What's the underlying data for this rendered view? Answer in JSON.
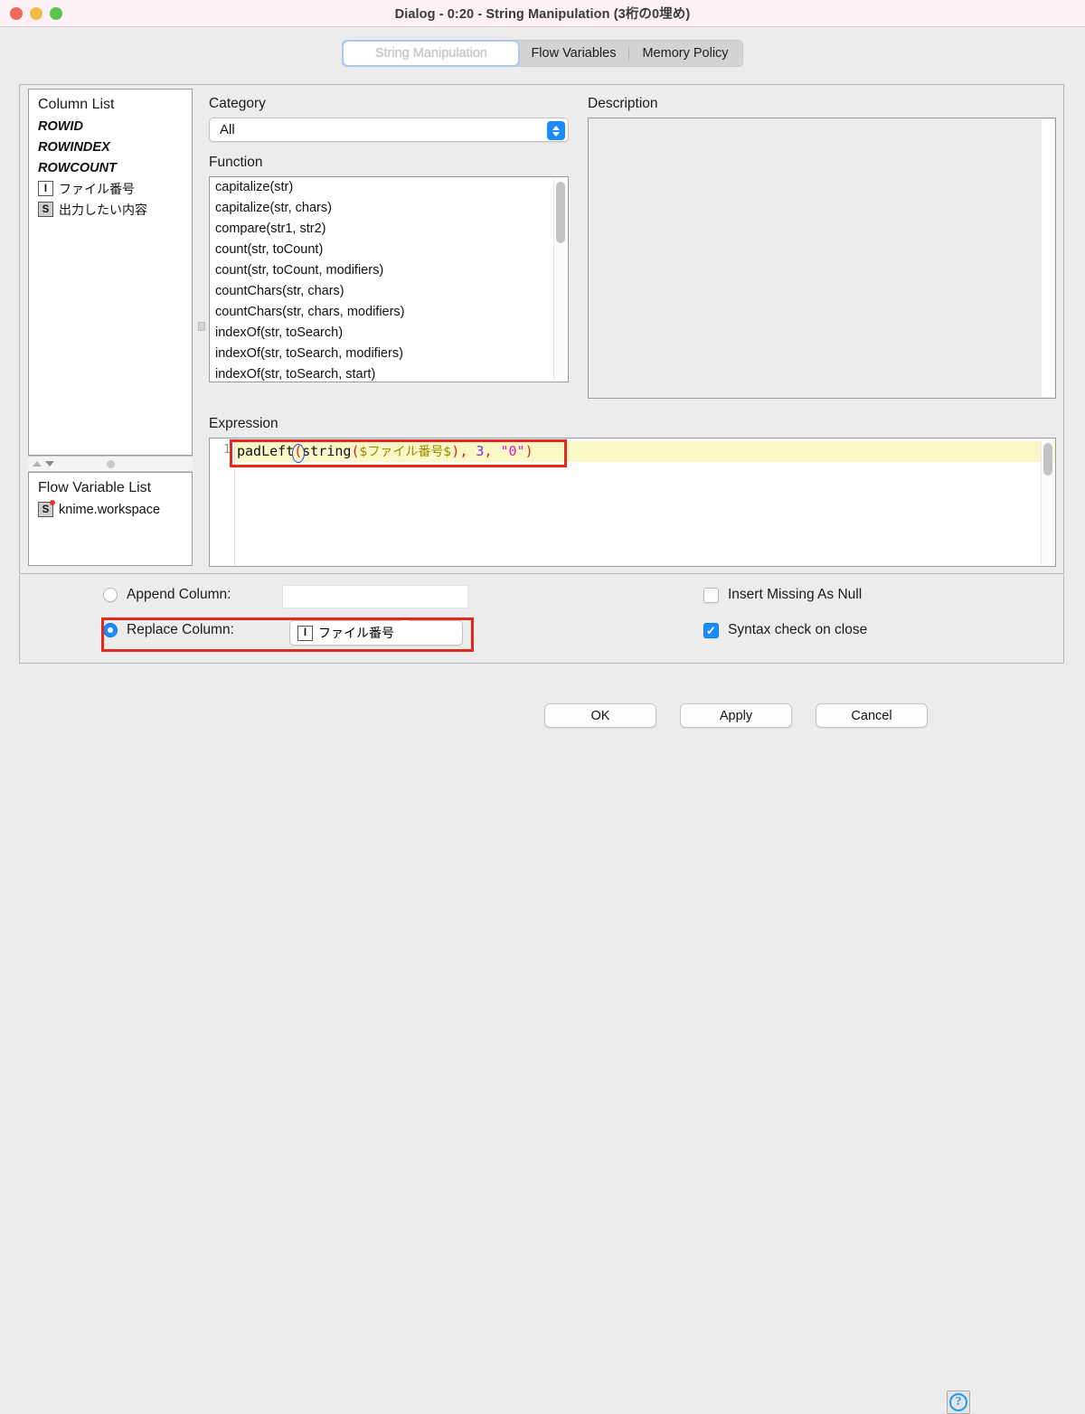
{
  "window": {
    "title": "Dialog - 0:20 - String Manipulation (3桁の0埋め)",
    "traffic_lights": [
      "close-red",
      "minimize-yellow",
      "zoom-green"
    ]
  },
  "tabs": [
    {
      "label": "String Manipulation",
      "active": true
    },
    {
      "label": "Flow Variables",
      "active": false
    },
    {
      "label": "Memory Policy",
      "active": false
    }
  ],
  "column_list": {
    "title": "Column List",
    "items": [
      {
        "label": "ROWID",
        "icon": "",
        "style": "italic"
      },
      {
        "label": "ROWINDEX",
        "icon": "",
        "style": "italic"
      },
      {
        "label": "ROWCOUNT",
        "icon": "",
        "style": "italic"
      },
      {
        "label": "ファイル番号",
        "icon": "I",
        "style": "normal"
      },
      {
        "label": "出力したい内容",
        "icon": "S",
        "style": "normal"
      }
    ]
  },
  "flow_variable_list": {
    "title": "Flow Variable List",
    "items": [
      {
        "label": "knime.workspace",
        "icon": "S"
      }
    ]
  },
  "category": {
    "label": "Category",
    "selected": "All"
  },
  "function": {
    "label": "Function",
    "items": [
      "capitalize(str)",
      "capitalize(str, chars)",
      "compare(str1, str2)",
      "count(str, toCount)",
      "count(str, toCount, modifiers)",
      "countChars(str, chars)",
      "countChars(str, chars, modifiers)",
      "indexOf(str, toSearch)",
      "indexOf(str, toSearch, modifiers)",
      "indexOf(str, toSearch, start)"
    ]
  },
  "description": {
    "label": "Description",
    "body": ""
  },
  "expression": {
    "label": "Expression",
    "line_number": "1",
    "text": "padLeft(string($ファイル番号$), 3, \"0\")",
    "tokens": {
      "fn1": "padLeft",
      "paren_open_matched": "(",
      "fn2": "string",
      "paren_open2": "(",
      "variable": "$ファイル番号$",
      "paren_close2": ")",
      "comma1": ", ",
      "number": "3",
      "comma2": ", ",
      "string_literal": "\"0\"",
      "paren_close1": ")"
    },
    "colors": {
      "highlight_line": "#fbf8c8",
      "paren": "#e01b1b",
      "variable": "#9a8a00",
      "number": "#7a2ee0",
      "string": "#e61ab4",
      "bracket_match_outline": "#2a3fd8"
    }
  },
  "options": {
    "append_column": {
      "label": "Append Column:",
      "selected": false,
      "value": "",
      "placeholder": ""
    },
    "replace_column": {
      "label": "Replace Column:",
      "selected": true,
      "value": "ファイル番号",
      "value_icon": "I"
    },
    "insert_missing_as_null": {
      "label": "Insert Missing As Null",
      "checked": false
    },
    "syntax_check_on_close": {
      "label": "Syntax check on close",
      "checked": true,
      "check_glyph": "✓"
    }
  },
  "footer": {
    "ok": "OK",
    "apply": "Apply",
    "cancel": "Cancel",
    "help": "?"
  },
  "annotations": {
    "accent_color": "#e8271c",
    "boxes": [
      "expression-highlight",
      "replace-column-highlight"
    ]
  }
}
